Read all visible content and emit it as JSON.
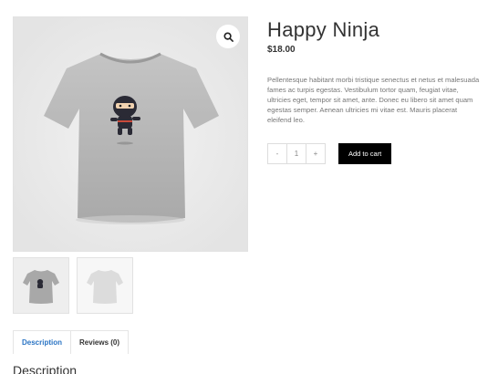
{
  "product": {
    "title": "Happy Ninja",
    "price": "$18.00",
    "description": "Pellentesque habitant morbi tristique senectus et netus et malesuada fames ac turpis egestas. Vestibulum tortor quam, feugiat vitae, ultricies eget, tempor sit amet, ante. Donec eu libero sit amet quam egestas semper. Aenean ultricies mi vitae est. Mauris placerat eleifend leo."
  },
  "gallery": {
    "zoom_icon": "search-icon",
    "thumbnails": [
      "tshirt-dark-ninja",
      "tshirt-plain-light"
    ]
  },
  "cart": {
    "minus": "-",
    "quantity": "1",
    "plus": "+",
    "add_label": "Add to cart"
  },
  "tabs": [
    {
      "label": "Description"
    },
    {
      "label": "Reviews (0)"
    }
  ],
  "section": {
    "heading": "Description"
  },
  "colors": {
    "accent": "#2a74c4",
    "button": "#000000"
  }
}
